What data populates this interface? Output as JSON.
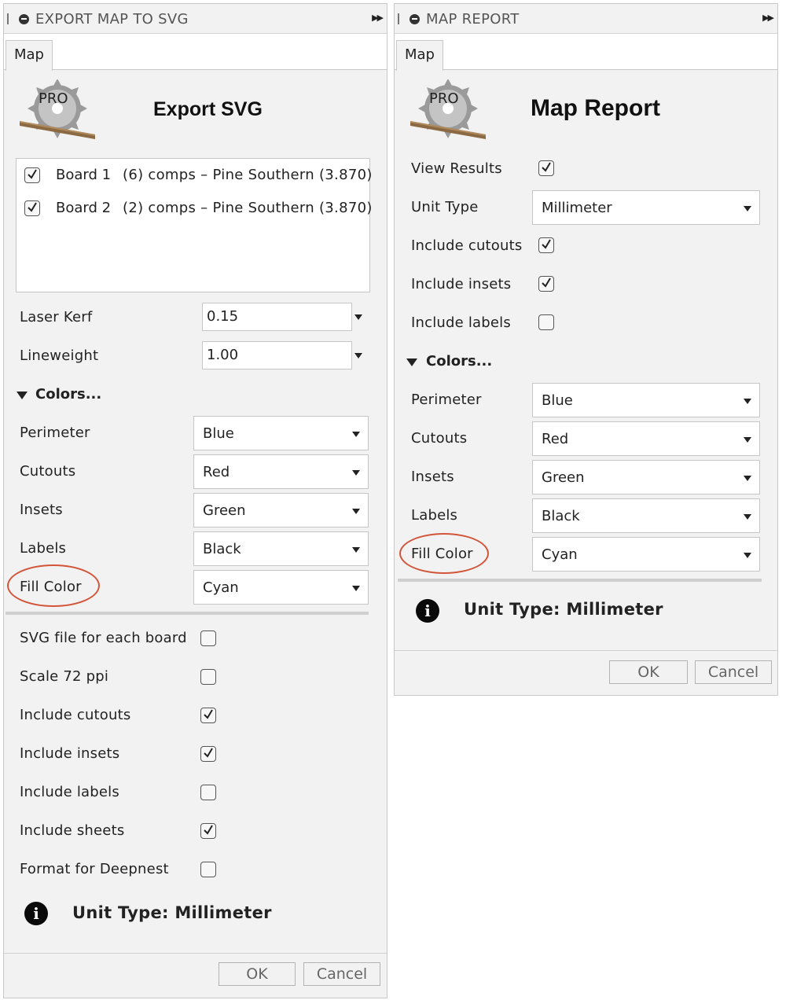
{
  "export_panel": {
    "title": "EXPORT MAP TO SVG",
    "tab": "Map",
    "header": "Export SVG",
    "logo_text": "PRO",
    "boards": [
      {
        "checked": true,
        "name": "Board 1",
        "desc": "(6) comps – Pine Southern (3.870)"
      },
      {
        "checked": true,
        "name": "Board 2",
        "desc": "(2) comps – Pine Southern (3.870)"
      }
    ],
    "laser_kerf": {
      "label": "Laser Kerf",
      "value": "0.15"
    },
    "lineweight": {
      "label": "Lineweight",
      "value": "1.00"
    },
    "colors_section": "Colors...",
    "colors": [
      {
        "label": "Perimeter",
        "value": "Blue"
      },
      {
        "label": "Cutouts",
        "value": "Red"
      },
      {
        "label": "Insets",
        "value": "Green"
      },
      {
        "label": "Labels",
        "value": "Black"
      },
      {
        "label": "Fill Color",
        "value": "Cyan"
      }
    ],
    "options": [
      {
        "label": "SVG file for each board",
        "checked": false
      },
      {
        "label": "Scale 72 ppi",
        "checked": false
      },
      {
        "label": "Include cutouts",
        "checked": true
      },
      {
        "label": "Include insets",
        "checked": true
      },
      {
        "label": "Include labels",
        "checked": false
      },
      {
        "label": "Include sheets",
        "checked": true
      },
      {
        "label": "Format for Deepnest",
        "checked": false
      }
    ],
    "info": "Unit Type: Millimeter",
    "ok": "OK",
    "cancel": "Cancel"
  },
  "report_panel": {
    "title": "MAP REPORT",
    "tab": "Map",
    "header": "Map Report",
    "logo_text": "PRO",
    "view_results": {
      "label": "View Results",
      "checked": true
    },
    "unit_type": {
      "label": "Unit Type",
      "value": "Millimeter"
    },
    "options": [
      {
        "label": "Include cutouts",
        "checked": true
      },
      {
        "label": "Include insets",
        "checked": true
      },
      {
        "label": "Include labels",
        "checked": false
      }
    ],
    "colors_section": "Colors...",
    "colors": [
      {
        "label": "Perimeter",
        "value": "Blue"
      },
      {
        "label": "Cutouts",
        "value": "Red"
      },
      {
        "label": "Insets",
        "value": "Green"
      },
      {
        "label": "Labels",
        "value": "Black"
      },
      {
        "label": "Fill Color",
        "value": "Cyan"
      }
    ],
    "info": "Unit Type: Millimeter",
    "ok": "OK",
    "cancel": "Cancel"
  },
  "highlight_color": "#d2553a"
}
